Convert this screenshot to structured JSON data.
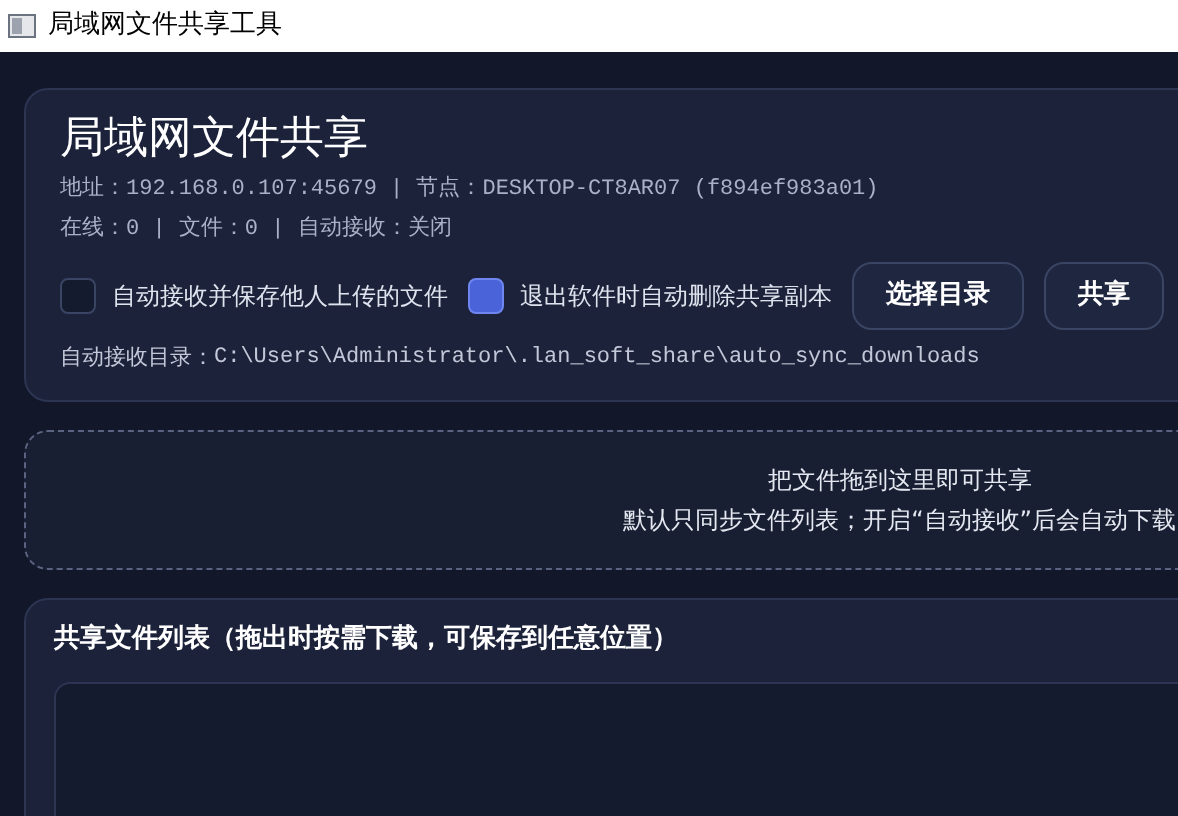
{
  "window": {
    "title": "局域网文件共享工具"
  },
  "header": {
    "title": "局域网文件共享",
    "info_lines": [
      "地址：192.168.0.107:45679 | 节点：DESKTOP-CT8AR07 (f894ef983a01)",
      "在线：0 | 文件：0 | 自动接收：关闭"
    ],
    "options": [
      {
        "label": "自动接收并保存他人上传的文件",
        "checked": false
      },
      {
        "label": "退出软件时自动删除共享副本",
        "checked": true
      }
    ],
    "buttons": [
      "选择目录",
      "共享"
    ],
    "directory": {
      "label": "自动接收目录：",
      "path": "C:\\Users\\Administrator\\.lan_soft_share\\auto_sync_downloads"
    }
  },
  "drop_zone": {
    "lines": [
      "把文件拖到这里即可共享",
      "默认只同步文件列表；开启“自动接收”后会自动下载"
    ]
  },
  "file_list": {
    "title": "共享文件列表（拖出时按需下载，可保存到任意位置）"
  }
}
